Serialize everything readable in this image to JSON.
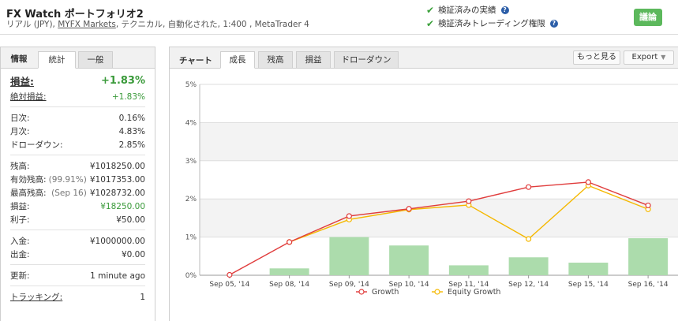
{
  "header": {
    "title": "FX Watch ポートフォリオ2",
    "subtitle_prefix": "リアル (JPY), ",
    "broker": "MYFX Markets",
    "subtitle_suffix": ", テクニカル, 自動化された, 1:400 , MetaTrader 4",
    "verified_track_record": "検証済みの実績",
    "verified_trading_privileges": "検証済みトレーディング権限",
    "help_glyph": "?",
    "discuss_button": "議論"
  },
  "left_panel": {
    "tabs": {
      "info": "情報",
      "stats": "統計",
      "general": "一般"
    },
    "gain": {
      "label": "損益:",
      "value": "+1.83%"
    },
    "abs_gain": {
      "label": "絶対損益:",
      "value": "+1.83%"
    },
    "daily": {
      "label": "日次:",
      "value": "0.16%"
    },
    "monthly": {
      "label": "月次:",
      "value": "4.83%"
    },
    "drawdown": {
      "label": "ドローダウン:",
      "value": "2.85%"
    },
    "balance": {
      "label": "残高:",
      "value": "¥1018250.00"
    },
    "equity": {
      "label": "有効残高:",
      "pre": "(99.91%)",
      "value": "¥1017353.00"
    },
    "highest": {
      "label": "最高残高:",
      "pre": "(Sep 16)",
      "value": "¥1028732.00"
    },
    "profit": {
      "label": "損益:",
      "value": "¥18250.00"
    },
    "interest": {
      "label": "利子:",
      "value": "¥50.00"
    },
    "deposits": {
      "label": "入金:",
      "value": "¥1000000.00"
    },
    "withdrawals": {
      "label": "出金:",
      "value": "¥0.00"
    },
    "updated": {
      "label": "更新:",
      "value": "1 minute ago"
    },
    "tracking": {
      "label": "トラッキング:",
      "value": "1"
    }
  },
  "right_panel": {
    "label": "チャート",
    "tabs": [
      "成長",
      "残高",
      "損益",
      "ドローダウン"
    ],
    "active_tab": 0,
    "more_button": "もっと見る",
    "export_button": "Export",
    "export_arrow": "▼"
  },
  "colors": {
    "growth": "#e03c3c",
    "equity": "#f5b800",
    "bars": "#acdcac",
    "green": "#3a9a3a",
    "band": "#f3f3f3"
  },
  "chart_data": {
    "type": "bar+line",
    "categories": [
      "Sep 05, '14",
      "Sep 08, '14",
      "Sep 09, '14",
      "Sep 10, '14",
      "Sep 11, '14",
      "Sep 12, '14",
      "Sep 15, '14",
      "Sep 16, '14"
    ],
    "yticks": [
      "0%",
      "1%",
      "2%",
      "3%",
      "4%",
      "5%"
    ],
    "ylim": [
      0,
      5
    ],
    "bars": [
      0,
      0.18,
      1.0,
      0.78,
      0.26,
      0.47,
      0.33,
      0.97
    ],
    "series": [
      {
        "name": "Growth",
        "values": [
          0.01,
          0.87,
          1.55,
          1.74,
          1.94,
          2.31,
          2.44,
          1.83
        ]
      },
      {
        "name": "Equity Growth",
        "values": [
          null,
          0.87,
          1.46,
          1.72,
          1.84,
          0.95,
          2.35,
          1.73
        ]
      }
    ],
    "legend_position": "bottom",
    "grid": true
  }
}
